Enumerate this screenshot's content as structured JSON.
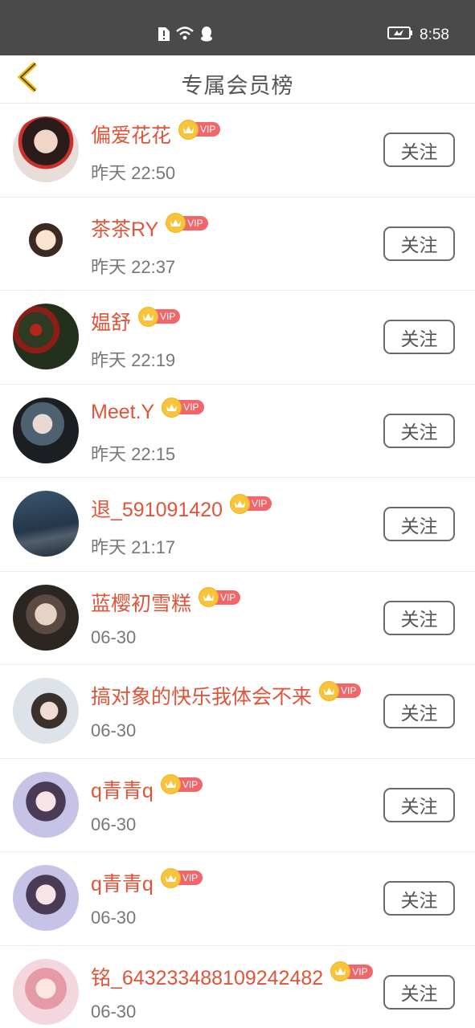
{
  "status_bar": {
    "time": "8:58"
  },
  "header": {
    "title": "专属会员榜"
  },
  "follow_label": "关注",
  "vip_label": "VIP",
  "members": [
    {
      "name": "偏爱花花",
      "time": "昨天 22:50"
    },
    {
      "name": "茶茶RY",
      "time": "昨天 22:37"
    },
    {
      "name": "媪舒",
      "time": "昨天 22:19"
    },
    {
      "name": "Meet.Y",
      "time": "昨天 22:15"
    },
    {
      "name": "退_591091420",
      "time": "昨天 21:17"
    },
    {
      "name": "蓝樱初雪糕",
      "time": "06-30"
    },
    {
      "name": "搞对象的快乐我体会不来",
      "time": "06-30"
    },
    {
      "name": "q青青q",
      "time": "06-30"
    },
    {
      "name": "q青青q",
      "time": "06-30"
    },
    {
      "name": "铭_643233488109242482",
      "time": "06-30"
    }
  ],
  "colors": {
    "name": "#e0553a",
    "status_bar": "#4a4a4a",
    "back_arrow": "#f0b400",
    "vip_badge": "#f2666a",
    "crown": "#f7c43c"
  }
}
